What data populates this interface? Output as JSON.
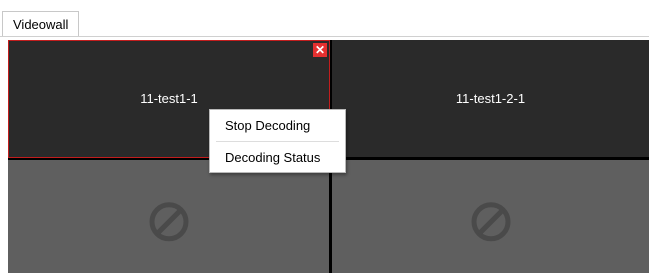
{
  "tabs": [
    {
      "label": "Videowall"
    }
  ],
  "wall": {
    "cells": [
      {
        "label": "11-test1-1",
        "state": "decoding",
        "selected": true
      },
      {
        "label": "11-test1-2-1",
        "state": "decoding",
        "selected": false
      },
      {
        "label": "",
        "state": "empty",
        "icon": "no-signal-icon"
      },
      {
        "label": "",
        "state": "empty",
        "icon": "no-signal-icon"
      }
    ],
    "close_glyph": "✕"
  },
  "context_menu": {
    "items": [
      {
        "label": "Stop Decoding"
      },
      {
        "label": "Decoding Status"
      }
    ]
  },
  "colors": {
    "selection_border": "#c21d1d",
    "close_button": "#e53030",
    "active_cell": "#2a2a2a",
    "empty_cell": "#5f5f5f"
  }
}
